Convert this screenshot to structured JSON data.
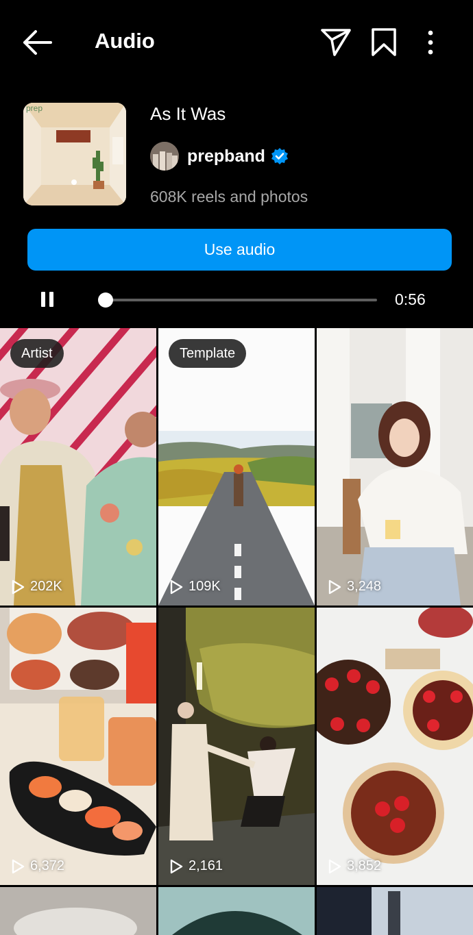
{
  "header": {
    "title": "Audio",
    "icons": [
      "back-arrow-icon",
      "send-icon",
      "bookmark-icon",
      "more-vertical-icon"
    ]
  },
  "audio": {
    "song_title": "As It Was",
    "cover_text": "prep",
    "artist": "prepband",
    "verified": true,
    "reels_count": "608K reels and photos",
    "use_audio_label": "Use audio",
    "elapsed": "0:56",
    "playback_progress": 0.02
  },
  "colors": {
    "accent": "#0095f6",
    "background": "#000000",
    "secondary_text": "#a8a8a8"
  },
  "grid": {
    "items": [
      {
        "badge": "Artist",
        "views": "202K"
      },
      {
        "badge": "Template",
        "views": "109K"
      },
      {
        "badge": "",
        "views": "3,248"
      },
      {
        "badge": "",
        "views": "6,372"
      },
      {
        "badge": "",
        "views": "2,161"
      },
      {
        "badge": "",
        "views": "3,852"
      }
    ]
  }
}
